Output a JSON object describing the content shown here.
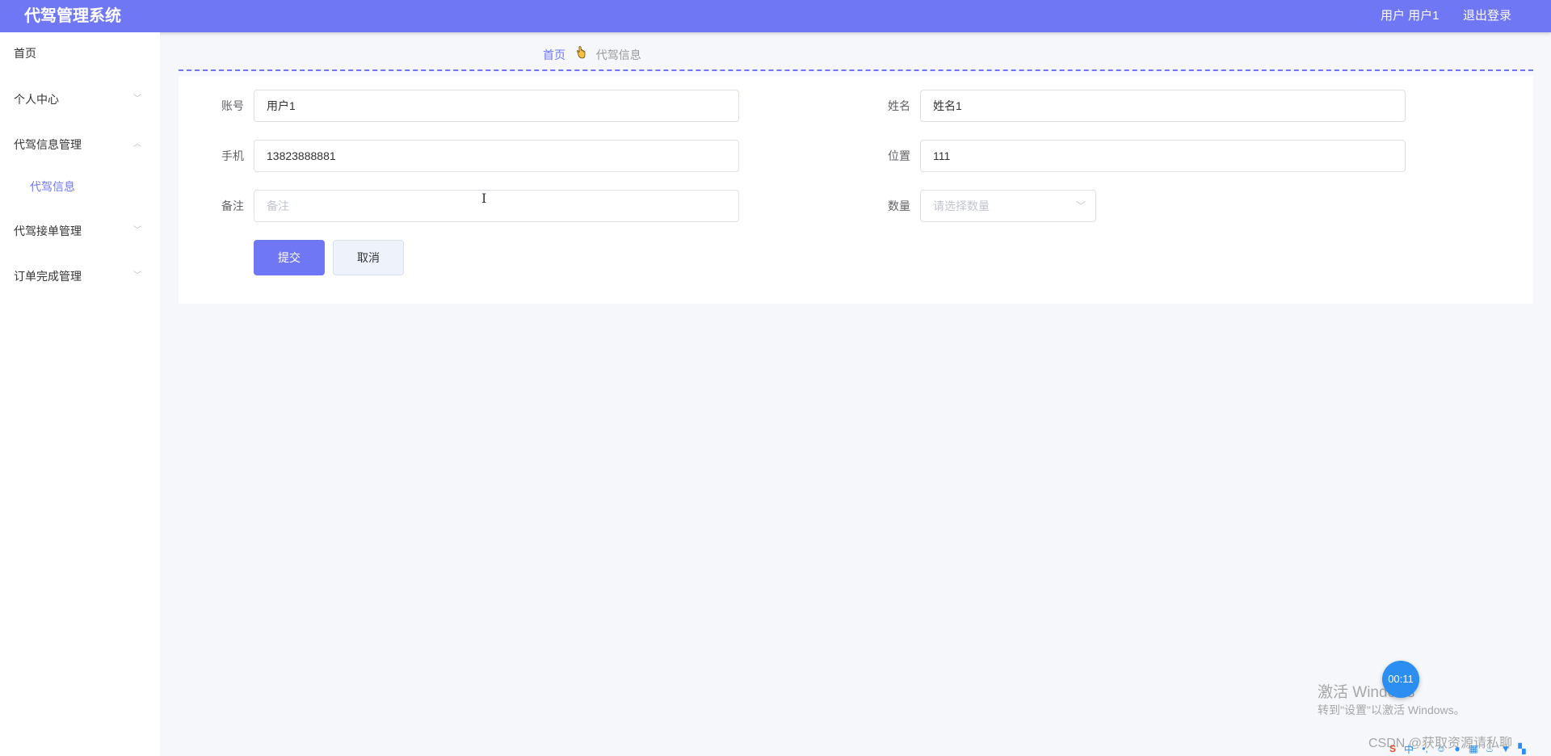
{
  "header": {
    "title": "代驾管理系统",
    "user_label": "用户 用户1",
    "logout_label": "退出登录"
  },
  "sidebar": {
    "items": [
      {
        "label": "首页",
        "chevron": ""
      },
      {
        "label": "个人中心",
        "chevron": "﹀"
      },
      {
        "label": "代驾信息管理",
        "chevron": "︿"
      },
      {
        "label": "代驾接单管理",
        "chevron": "﹀"
      },
      {
        "label": "订单完成管理",
        "chevron": "﹀"
      }
    ],
    "subitems": [
      {
        "label": "代驾信息"
      }
    ]
  },
  "breadcrumb": {
    "home": "首页",
    "separator_icon": "hand-icon",
    "current": "代驾信息"
  },
  "form": {
    "account": {
      "label": "账号",
      "value": "用户1"
    },
    "name": {
      "label": "姓名",
      "value": "姓名1"
    },
    "phone": {
      "label": "手机",
      "value": "13823888881"
    },
    "location": {
      "label": "位置",
      "value": "111"
    },
    "remark": {
      "label": "备注",
      "value": "",
      "placeholder": "备注"
    },
    "quantity": {
      "label": "数量",
      "placeholder": "请选择数量"
    },
    "submit_label": "提交",
    "cancel_label": "取消"
  },
  "overlay": {
    "timer": "00:11",
    "watermark_title": "激活 Windows",
    "watermark_sub": "转到\"设置\"以激活 Windows。",
    "csdn": "CSDN @获取资源请私聊"
  },
  "colors": {
    "accent": "#6f77f5",
    "background": "#f5f7fa"
  }
}
